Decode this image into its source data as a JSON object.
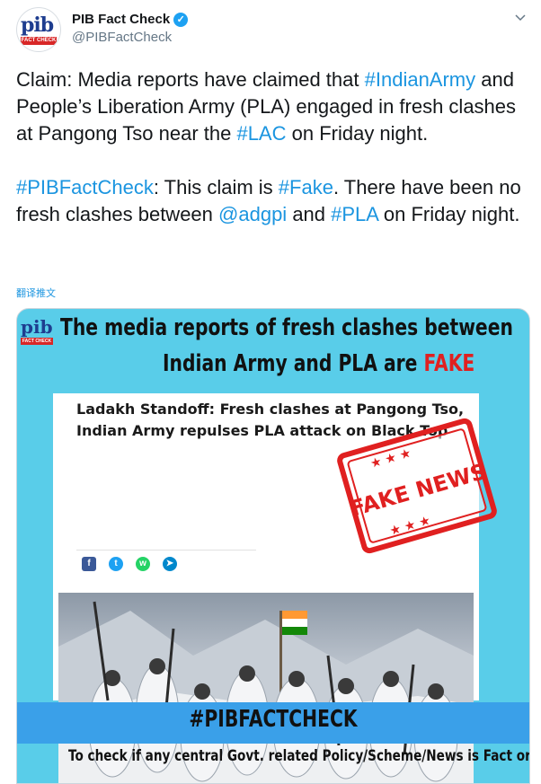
{
  "tweet": {
    "display_name": "PIB Fact Check",
    "handle": "@PIBFactCheck",
    "avatar_text": "pib",
    "avatar_band": "FACT CHECK",
    "paragraph1": {
      "t1": "Claim: Media reports have claimed that ",
      "tag1": "#IndianArmy",
      "t2": " and People’s Liberation Army (PLA) engaged in fresh clashes at Pangong Tso near the ",
      "tag2": "#LAC",
      "t3": " on Friday night."
    },
    "paragraph2": {
      "tag1": "#PIBFactCheck",
      "t1": ": This claim is ",
      "tag2": "#Fake",
      "t2": ". There have been no fresh clashes between ",
      "mention": "@adgpi",
      "t3": " and ",
      "tag3": "#PLA",
      "t4": " on Friday night."
    },
    "translate_label": "翻译推文"
  },
  "card": {
    "logo_text": "pib",
    "logo_band": "FACT CHECK",
    "headline_line1": "The media reports of fresh clashes between",
    "headline_line2_prefix": "Indian Army and PLA are ",
    "headline_fake": "FAKE",
    "news_title": "Ladakh Standoff: Fresh clashes at Pangong Tso, Indian Army repulses PLA attack on Black Top",
    "share_icons": [
      "facebook-icon",
      "twitter-icon",
      "whatsapp-icon",
      "telegram-icon"
    ],
    "stamp_text": "FAKE NEWS",
    "footer_title": "#PIBFACTCHECK",
    "bottom_line": "To check if any central Govt. related Policy/Scheme/News is Fact or not -"
  },
  "colors": {
    "link": "#1b95e0",
    "card_background": "#59cde9",
    "footer_bar": "#3aa0e9",
    "fake_red": "#e02020"
  }
}
